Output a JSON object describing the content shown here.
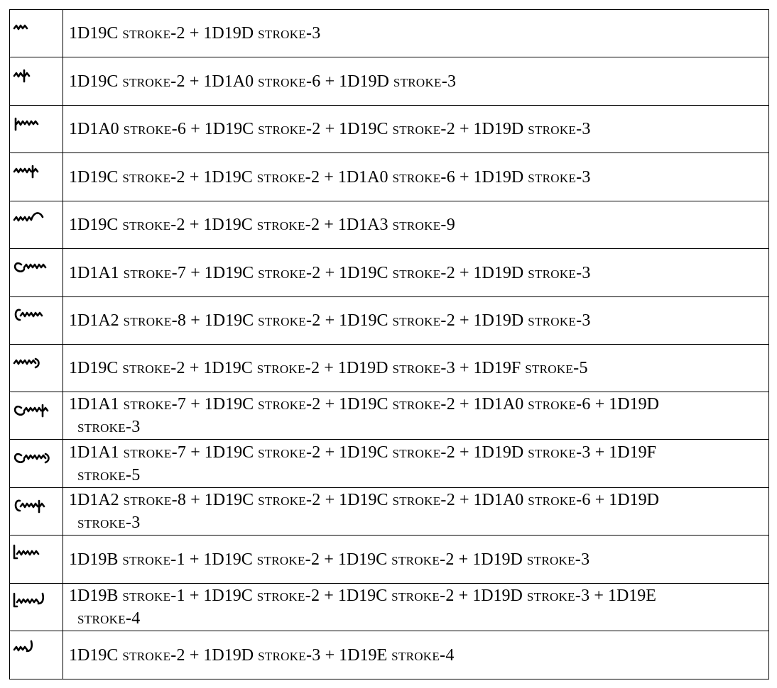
{
  "rows": [
    {
      "glyph_icon": "stroke-2-3-glyph-icon",
      "parts": [
        {
          "code": "1D19C",
          "name": "stroke-2"
        },
        {
          "code": "1D19D",
          "name": "stroke-3"
        }
      ]
    },
    {
      "glyph_icon": "stroke-2-6-3-glyph-icon",
      "parts": [
        {
          "code": "1D19C",
          "name": "stroke-2"
        },
        {
          "code": "1D1A0",
          "name": "stroke-6"
        },
        {
          "code": "1D19D",
          "name": "stroke-3"
        }
      ]
    },
    {
      "glyph_icon": "stroke-6-2-2-3-glyph-icon",
      "parts": [
        {
          "code": "1D1A0",
          "name": "stroke-6"
        },
        {
          "code": "1D19C",
          "name": "stroke-2"
        },
        {
          "code": "1D19C",
          "name": "stroke-2"
        },
        {
          "code": "1D19D",
          "name": "stroke-3"
        }
      ]
    },
    {
      "glyph_icon": "stroke-2-2-6-3-glyph-icon",
      "parts": [
        {
          "code": "1D19C",
          "name": "stroke-2"
        },
        {
          "code": "1D19C",
          "name": "stroke-2"
        },
        {
          "code": "1D1A0",
          "name": "stroke-6"
        },
        {
          "code": "1D19D",
          "name": "stroke-3"
        }
      ]
    },
    {
      "glyph_icon": "stroke-2-2-9-glyph-icon",
      "parts": [
        {
          "code": "1D19C",
          "name": "stroke-2"
        },
        {
          "code": "1D19C",
          "name": "stroke-2"
        },
        {
          "code": "1D1A3",
          "name": "stroke-9"
        }
      ]
    },
    {
      "glyph_icon": "stroke-7-2-2-3-glyph-icon",
      "parts": [
        {
          "code": "1D1A1",
          "name": "stroke-7"
        },
        {
          "code": "1D19C",
          "name": "stroke-2"
        },
        {
          "code": "1D19C",
          "name": "stroke-2"
        },
        {
          "code": "1D19D",
          "name": "stroke-3"
        }
      ]
    },
    {
      "glyph_icon": "stroke-8-2-2-3-glyph-icon",
      "parts": [
        {
          "code": "1D1A2",
          "name": "stroke-8"
        },
        {
          "code": "1D19C",
          "name": "stroke-2"
        },
        {
          "code": "1D19C",
          "name": "stroke-2"
        },
        {
          "code": "1D19D",
          "name": "stroke-3"
        }
      ]
    },
    {
      "glyph_icon": "stroke-2-2-3-5-glyph-icon",
      "parts": [
        {
          "code": "1D19C",
          "name": "stroke-2"
        },
        {
          "code": "1D19C",
          "name": "stroke-2"
        },
        {
          "code": "1D19D",
          "name": "stroke-3"
        },
        {
          "code": "1D19F",
          "name": "stroke-5"
        }
      ]
    },
    {
      "glyph_icon": "stroke-7-2-2-6-3-glyph-icon",
      "parts": [
        {
          "code": "1D1A1",
          "name": "stroke-7"
        },
        {
          "code": "1D19C",
          "name": "stroke-2"
        },
        {
          "code": "1D19C",
          "name": "stroke-2"
        },
        {
          "code": "1D1A0",
          "name": "stroke-6"
        },
        {
          "code": "1D19D",
          "name": "stroke-3"
        }
      ]
    },
    {
      "glyph_icon": "stroke-7-2-2-3-5-glyph-icon",
      "parts": [
        {
          "code": "1D1A1",
          "name": "stroke-7"
        },
        {
          "code": "1D19C",
          "name": "stroke-2"
        },
        {
          "code": "1D19C",
          "name": "stroke-2"
        },
        {
          "code": "1D19D",
          "name": "stroke-3"
        },
        {
          "code": "1D19F",
          "name": "stroke-5"
        }
      ]
    },
    {
      "glyph_icon": "stroke-8-2-2-6-3-glyph-icon",
      "parts": [
        {
          "code": "1D1A2",
          "name": "stroke-8"
        },
        {
          "code": "1D19C",
          "name": "stroke-2"
        },
        {
          "code": "1D19C",
          "name": "stroke-2"
        },
        {
          "code": "1D1A0",
          "name": "stroke-6"
        },
        {
          "code": "1D19D",
          "name": "stroke-3"
        }
      ]
    },
    {
      "glyph_icon": "stroke-1-2-2-3-glyph-icon",
      "parts": [
        {
          "code": "1D19B",
          "name": "stroke-1"
        },
        {
          "code": "1D19C",
          "name": "stroke-2"
        },
        {
          "code": "1D19C",
          "name": "stroke-2"
        },
        {
          "code": "1D19D",
          "name": "stroke-3"
        }
      ]
    },
    {
      "glyph_icon": "stroke-1-2-2-3-4-glyph-icon",
      "parts": [
        {
          "code": "1D19B",
          "name": "stroke-1"
        },
        {
          "code": "1D19C",
          "name": "stroke-2"
        },
        {
          "code": "1D19C",
          "name": "stroke-2"
        },
        {
          "code": "1D19D",
          "name": "stroke-3"
        },
        {
          "code": "1D19E",
          "name": "stroke-4"
        }
      ]
    },
    {
      "glyph_icon": "stroke-2-3-4-glyph-icon",
      "parts": [
        {
          "code": "1D19C",
          "name": "stroke-2"
        },
        {
          "code": "1D19D",
          "name": "stroke-3"
        },
        {
          "code": "1D19E",
          "name": "stroke-4"
        }
      ]
    }
  ]
}
